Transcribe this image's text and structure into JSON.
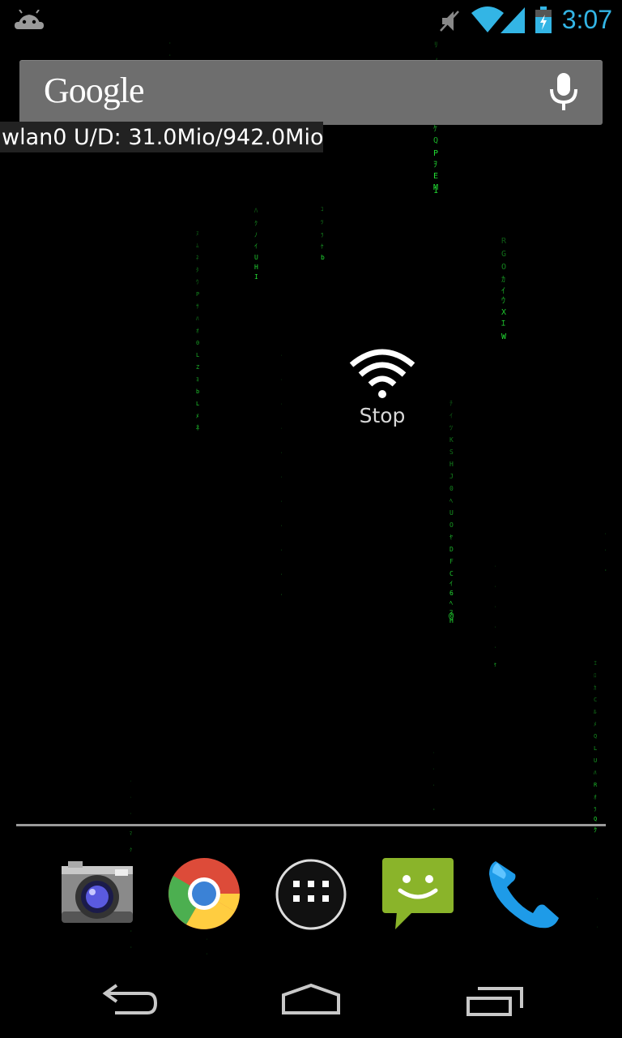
{
  "status_bar": {
    "time": "3:07",
    "icons": [
      "android-debug-icon",
      "mute-icon",
      "wifi-icon",
      "signal-icon",
      "battery-charging-icon"
    ],
    "accent_color": "#33b5e5"
  },
  "search_bar": {
    "logo_text": "Google",
    "voice_icon": "mic-icon"
  },
  "network_overlay": {
    "text": "wlan0 U/D: 31.0Mio/942.0Mio"
  },
  "widget": {
    "label": "Stop",
    "icon": "wifi-icon"
  },
  "dock": {
    "apps": [
      {
        "name": "Camera",
        "icon": "camera-icon"
      },
      {
        "name": "Chrome",
        "icon": "chrome-icon"
      },
      {
        "name": "All apps",
        "icon": "app-drawer-icon"
      },
      {
        "name": "Messaging",
        "icon": "messaging-icon"
      },
      {
        "name": "Phone",
        "icon": "phone-icon"
      }
    ]
  },
  "nav_bar": {
    "buttons": [
      "back-icon",
      "home-icon",
      "recents-icon"
    ]
  },
  "wallpaper": {
    "type": "matrix-rain",
    "glyph_color": "#22dd33"
  }
}
